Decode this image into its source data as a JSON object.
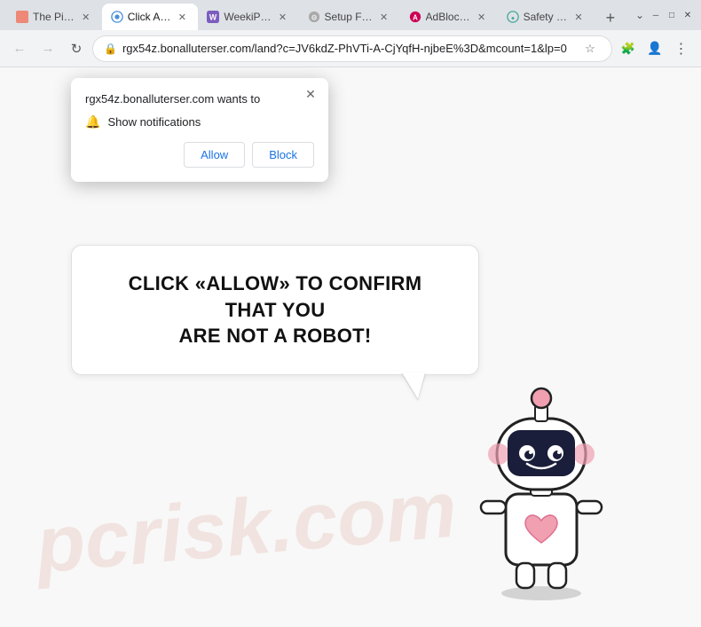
{
  "titlebar": {
    "tabs": [
      {
        "id": "tab1",
        "label": "The Pi…",
        "favicon_color": "#e87",
        "active": false
      },
      {
        "id": "tab2",
        "label": "Click A…",
        "favicon_color": "#4a90d9",
        "active": true
      },
      {
        "id": "tab3",
        "label": "WeekiP…",
        "favicon_color": "#7c5cbf",
        "active": false
      },
      {
        "id": "tab4",
        "label": "Setup F…",
        "favicon_color": "#aaa",
        "active": false
      },
      {
        "id": "tab5",
        "label": "AdBloc…",
        "favicon_color": "#e05",
        "active": false
      },
      {
        "id": "tab6",
        "label": "Safety …",
        "favicon_color": "#4a9",
        "active": false
      }
    ],
    "new_tab_label": "+",
    "controls": {
      "minimize": "─",
      "maximize": "□",
      "close": "✕"
    }
  },
  "navbar": {
    "back_title": "Back",
    "forward_title": "Forward",
    "refresh_title": "Refresh",
    "address": "rgx54z.bonalluterser.com/land?c=JV6kdZ-PhVTi-A-CjYqfH-njbeE%3D&mcount=1&lp=0",
    "bookmark_title": "Bookmark",
    "extensions_title": "Extensions",
    "account_title": "Account",
    "menu_title": "Menu"
  },
  "popup": {
    "domain": "rgx54z.bonalluterser.com wants to",
    "close_label": "✕",
    "notification_text": "Show notifications",
    "allow_label": "Allow",
    "block_label": "Block"
  },
  "main": {
    "message_line1": "CLICK «ALLOW» TO CONFIRM THAT YOU",
    "message_line2": "ARE NOT A ROBOT!",
    "watermark": "pcrisk.com"
  }
}
